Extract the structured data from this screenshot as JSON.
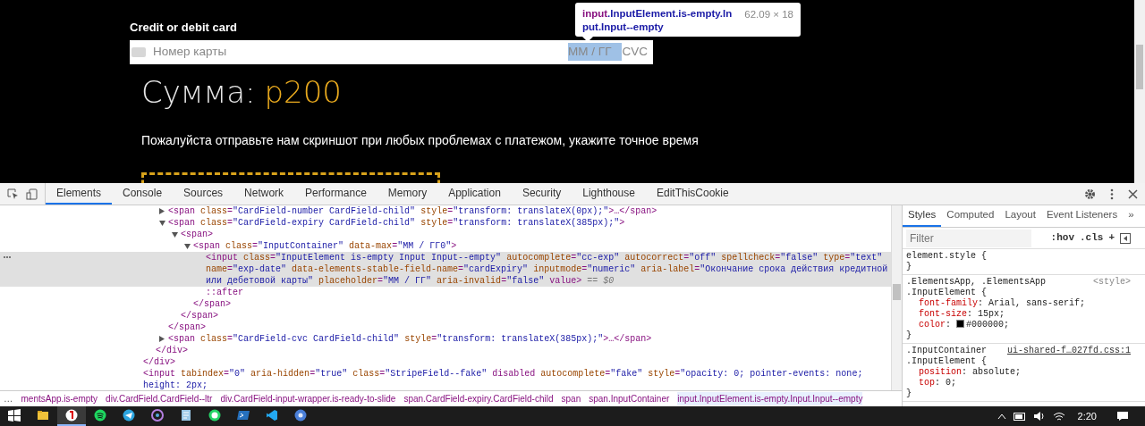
{
  "page": {
    "card_label": "Credit or debit card",
    "card_placeholder": "Номер карты",
    "expiry_placeholder": "ММ / ГГ",
    "expiry_highlighted": true,
    "cvc_placeholder": "CVC",
    "amount_label": "Сумма:",
    "amount": "р200",
    "notice": "Пожалуйста отправьте нам скриншот при любых проблемах с платежом, укажите точное время"
  },
  "inspect_tooltip": {
    "tag": "input",
    "classes": ".InputElement.is-empty.Input.Input--empty",
    "size": "62.09 × 18"
  },
  "devtools": {
    "tabs": [
      {
        "label": "Elements",
        "selected": true
      },
      {
        "label": "Console",
        "selected": false
      },
      {
        "label": "Sources",
        "selected": false
      },
      {
        "label": "Network",
        "selected": false
      },
      {
        "label": "Performance",
        "selected": false
      },
      {
        "label": "Memory",
        "selected": false
      },
      {
        "label": "Application",
        "selected": false
      },
      {
        "label": "Security",
        "selected": false
      },
      {
        "label": "Lighthouse",
        "selected": false
      },
      {
        "label": "EditThisCookie",
        "selected": false
      }
    ],
    "dom_tree": [
      {
        "close": "</div>",
        "children": [
          {
            "close": "</div>",
            "children": [
              {
                "markup": "<span class=\"CardField-number CardField-child\" style=\"transform: translateX(0px);\">…</span>",
                "expanded": false
              },
              {
                "markup": "<span class=\"CardField-expiry CardField-child\" style=\"transform: translateX(385px);\">",
                "expanded": true,
                "close": "</span>",
                "children": [
                  {
                    "markup": "<span>",
                    "expanded": true,
                    "close": "</span>",
                    "children": [
                      {
                        "markup": "<span class=\"InputContainer\" data-max=\"ММ / ГГ0\">",
                        "expanded": true,
                        "close": "</span>",
                        "children": [
                          {
                            "markup": "<input class=\"InputElement is-empty Input Input--empty\" autocomplete=\"cc-exp\" autocorrect=\"off\" spellcheck=\"false\" type=\"text\" name=\"exp-date\" data-elements-stable-field-name=\"cardExpiry\" inputmode=\"numeric\" aria-label=\"Окончание срока действия кредитной или дебетовой карты\" placeholder=\"ММ / ГГ\" aria-invalid=\"false\" value>",
                            "suffix": "== $0",
                            "selected": true
                          },
                          {
                            "markup": "::after"
                          }
                        ]
                      }
                    ]
                  }
                ]
              },
              {
                "markup": "<span class=\"CardField-cvc CardField-child\" style=\"transform: translateX(385px);\">…</span>",
                "expanded": false
              }
            ]
          }
        ]
      },
      {
        "markup": "<input tabindex=\"0\" aria-hidden=\"true\" class=\"StripeField--fake\" disabled autocomplete=\"fake\" style=\"opacity: 0; pointer-events: none; height: 2px;"
      }
    ],
    "breadcrumb_overflow": "…",
    "breadcrumbs": [
      {
        "label": "mentsApp.is-empty",
        "selected": false
      },
      {
        "label": "div.CardField.CardField--ltr",
        "selected": false
      },
      {
        "label": "div.CardField-input-wrapper.is-ready-to-slide",
        "selected": false
      },
      {
        "label": "span.CardField-expiry.CardField-child",
        "selected": false
      },
      {
        "label": "span",
        "selected": false
      },
      {
        "label": "span.InputContainer",
        "selected": false
      },
      {
        "label": "input.InputElement.is-empty.Input.Input--empty",
        "selected": true
      }
    ],
    "side_tabs": [
      {
        "label": "Styles",
        "selected": true
      },
      {
        "label": "Computed",
        "selected": false
      },
      {
        "label": "Layout",
        "selected": false
      },
      {
        "label": "Event Listeners",
        "selected": false
      }
    ],
    "side_more": "»",
    "filter_placeholder": "Filter",
    "hov": ":hov",
    "cls": ".cls",
    "plus": "+",
    "rules": [
      {
        "selectors": [
          "element.style {"
        ],
        "close": "}"
      },
      {
        "selectors": [
          ".ElementsApp, .ElementsApp",
          ".InputElement {"
        ],
        "source": "<style>",
        "source_link": false,
        "declarations": [
          {
            "text": "font-family: Arial, sans-serif;"
          },
          {
            "text": "font-size: 15px;"
          },
          {
            "text": "color: #000000;",
            "color": "#000000"
          }
        ],
        "close": "}"
      },
      {
        "selectors": [
          ".InputContainer",
          ".InputElement {"
        ],
        "source": "ui-shared-f…027fd.css:1",
        "source_link": true,
        "declarations": [
          {
            "text": "position: absolute;"
          },
          {
            "text": "top: 0;"
          }
        ],
        "close": "}"
      }
    ]
  },
  "taskbar": {
    "apps": [
      {
        "kind": "explorer",
        "selected": false
      },
      {
        "kind": "yandex",
        "selected": true
      },
      {
        "kind": "spotify",
        "selected": false
      },
      {
        "kind": "telegram",
        "selected": false
      },
      {
        "kind": "orb",
        "selected": false
      },
      {
        "kind": "notepad",
        "selected": false
      },
      {
        "kind": "whatsapp",
        "selected": false
      },
      {
        "kind": "powershell",
        "selected": false
      },
      {
        "kind": "vscode",
        "selected": false
      },
      {
        "kind": "chrome",
        "selected": false
      }
    ],
    "clock": "2:20"
  }
}
